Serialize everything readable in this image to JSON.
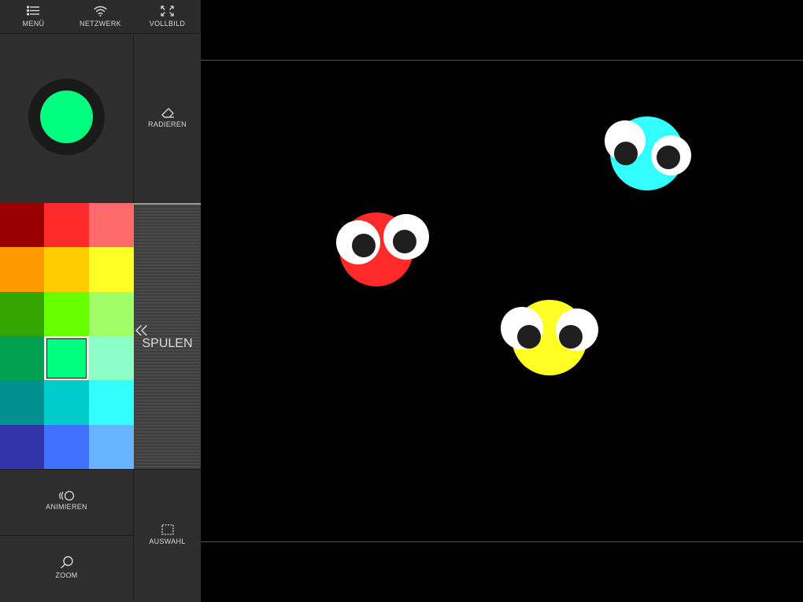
{
  "toolbar": {
    "menu_label": "MENÜ",
    "network_label": "NETZWERK",
    "fullscreen_label": "VOLLBILD"
  },
  "current_color": "#00ff7f",
  "tools": {
    "erase_label": "RADIEREN",
    "spool_label": "SPULEN",
    "animate_label": "ANIMIEREN",
    "select_label": "AUSWAHL",
    "zoom_label": "ZOOM"
  },
  "palette": [
    [
      "#990000",
      "#ff2a2a",
      "#ff6b6b"
    ],
    [
      "#ff9900",
      "#ffcc00",
      "#ffff26"
    ],
    [
      "#33a600",
      "#66ff00",
      "#a0ff66"
    ],
    [
      "#00a150",
      "#00ff7f",
      "#8cffc8"
    ],
    [
      "#009090",
      "#00cccc",
      "#33ffff"
    ],
    [
      "#3333aa",
      "#4070ff",
      "#66b3ff"
    ]
  ],
  "selected_palette_index": [
    3,
    1
  ],
  "creatures": [
    {
      "name": "red",
      "color": "#ff2a2a"
    },
    {
      "name": "cyan",
      "color": "#33ffff"
    },
    {
      "name": "yellow",
      "color": "#ffff26"
    }
  ]
}
